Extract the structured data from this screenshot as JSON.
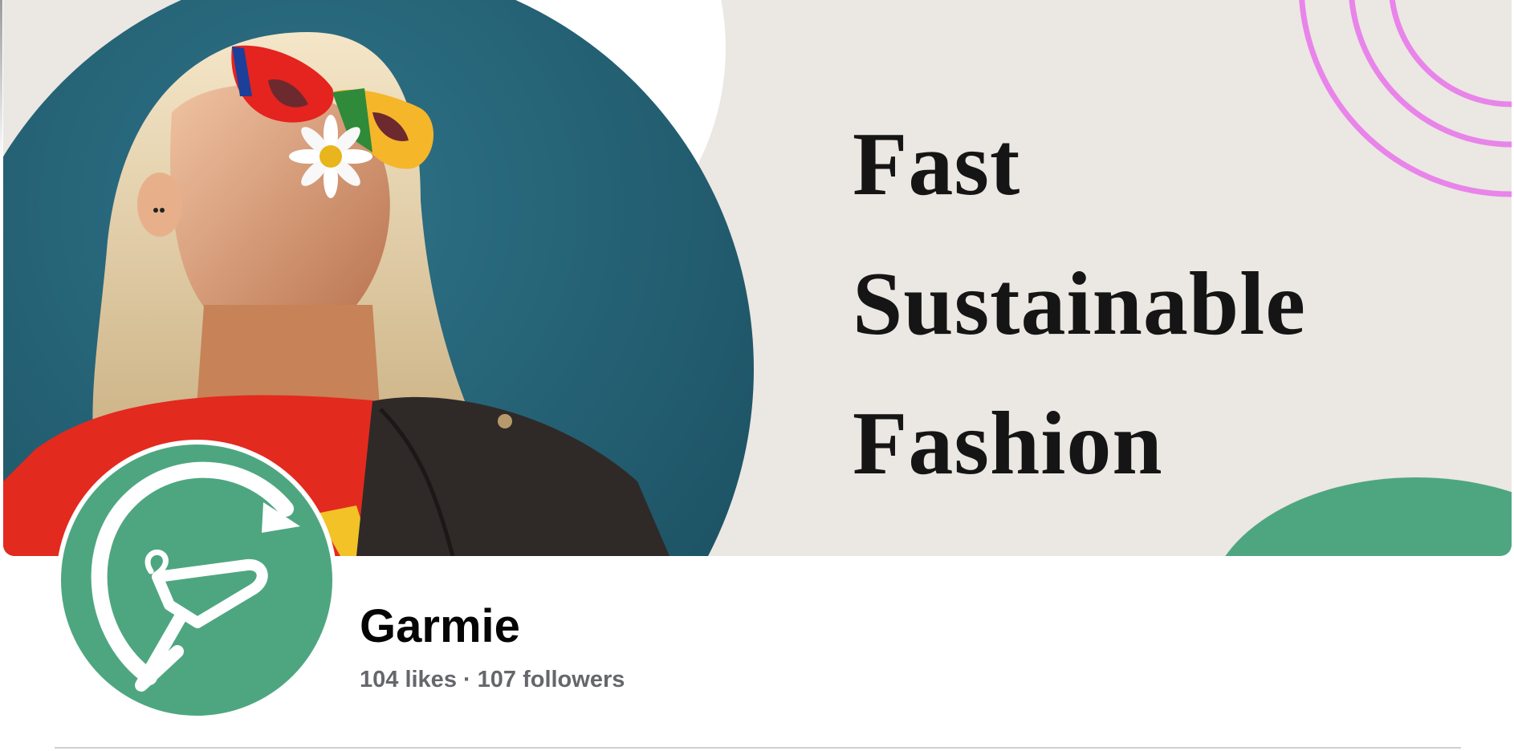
{
  "page": {
    "name": "Garmie",
    "likes": "104 likes",
    "separator": "·",
    "followers": "107 followers"
  },
  "cover": {
    "tagline": [
      "Fast",
      "Sustainable",
      "Fashion"
    ]
  },
  "colors": {
    "brand_green": "#4ea681",
    "cover_background": "#ebe7e2",
    "photo_teal": "#1f5b6c",
    "accent_pink": "#e884ea",
    "stats_gray": "#65676b"
  },
  "icons": {
    "avatar": "hanger-arrow-logo-icon"
  }
}
